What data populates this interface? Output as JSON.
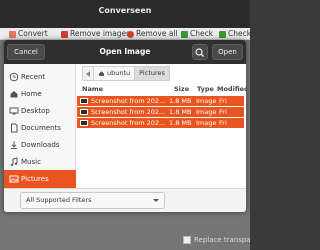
{
  "window": {
    "title": "Converseen"
  },
  "toolbar": {
    "items": [
      {
        "label": "Convert",
        "icon": "convert-icon"
      },
      {
        "label": "Remove images",
        "icon": "remove-icon"
      },
      {
        "label": "Remove all",
        "icon": "remove-all-icon"
      },
      {
        "label": "Check",
        "icon": "check-icon"
      },
      {
        "label": "Check",
        "icon": "check-icon"
      }
    ]
  },
  "dialog": {
    "title": "Open Image",
    "cancel_label": "Cancel",
    "open_label": "Open",
    "sidebar": [
      {
        "label": "Recent",
        "icon": "clock-icon"
      },
      {
        "label": "Home",
        "icon": "home-icon"
      },
      {
        "label": "Desktop",
        "icon": "desktop-icon"
      },
      {
        "label": "Documents",
        "icon": "documents-icon"
      },
      {
        "label": "Downloads",
        "icon": "downloads-icon"
      },
      {
        "label": "Music",
        "icon": "music-icon"
      },
      {
        "label": "Pictures",
        "icon": "pictures-icon",
        "active": true
      }
    ],
    "path": {
      "home": "ubuntu",
      "current": "Pictures"
    },
    "columns": {
      "name": "Name",
      "size": "Size",
      "type": "Type",
      "modified": "Modified"
    },
    "files": [
      {
        "name": "Screenshot from 202...",
        "size": "1.8 MB",
        "type": "Image",
        "modified": "Fri"
      },
      {
        "name": "Screenshot from 202...",
        "size": "1.8 MB",
        "type": "Image",
        "modified": "Fri"
      },
      {
        "name": "Screenshot from 202...",
        "size": "1.8 MB",
        "type": "Image",
        "modified": "Fri"
      }
    ],
    "filter": "All Supported Filters"
  },
  "options": {
    "replace_label": "Replace transparen"
  },
  "colors": {
    "accent": "#e95420",
    "header": "#2f2f2f"
  }
}
